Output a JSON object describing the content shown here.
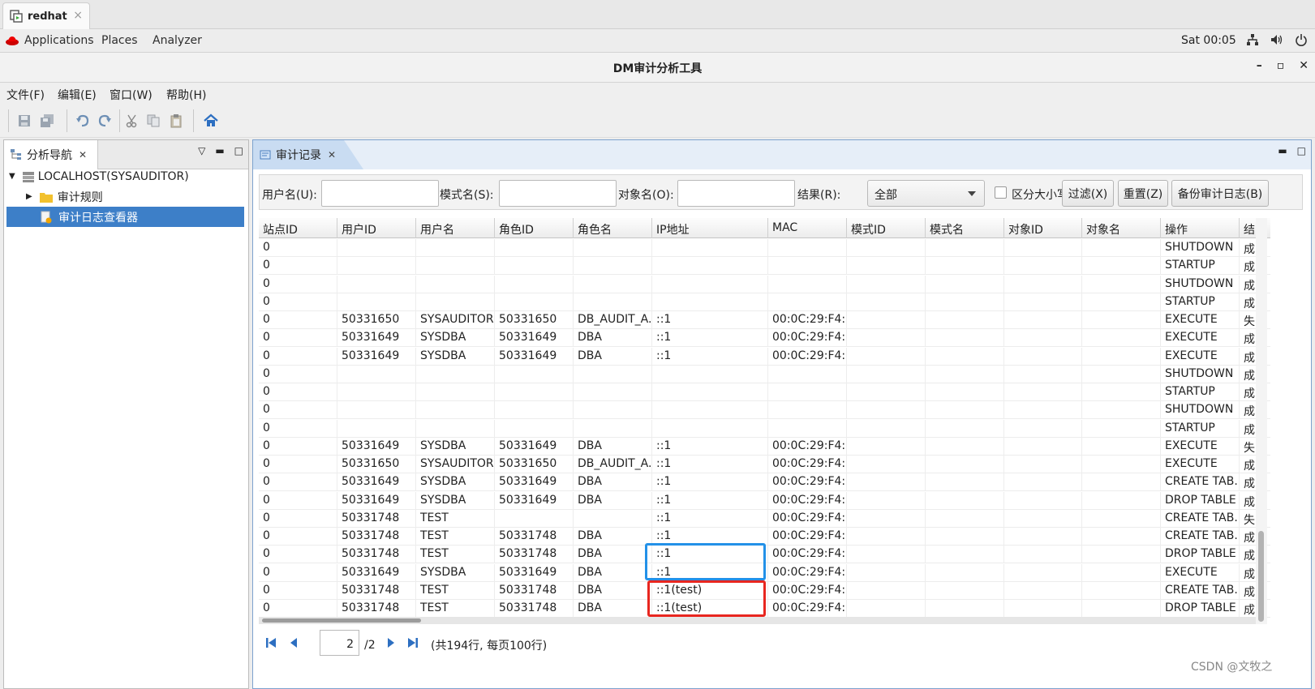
{
  "browser_tab": {
    "label": "redhat",
    "close": "×"
  },
  "topbar": {
    "applications": "Applications",
    "places": "Places",
    "analyzer": "Analyzer",
    "clock": "Sat 00:05"
  },
  "window": {
    "title": "DM审计分析工具",
    "minimize": "–",
    "maximize": "▫",
    "close": "✕"
  },
  "menu": {
    "file": "文件(F)",
    "edit": "编辑(E)",
    "window": "窗口(W)",
    "help": "帮助(H)"
  },
  "nav_panel": {
    "tab_label": "分析导航",
    "tree": {
      "root": "LOCALHOST(SYSAUDITOR)",
      "rules": "审计规则",
      "viewer": "审计日志查看器"
    }
  },
  "records_panel": {
    "tab_label": "审计记录"
  },
  "filter": {
    "username_label": "用户名(U):",
    "schema_label": "模式名(S):",
    "object_label": "对象名(O):",
    "result_label": "结果(R):",
    "result_value": "全部",
    "case_label": "区分大小写(C)",
    "filter_btn": "过滤(X)",
    "reset_btn": "重置(Z)",
    "backup_btn": "备份审计日志(B)"
  },
  "table": {
    "columns": [
      "站点ID",
      "用户ID",
      "用户名",
      "角色ID",
      "角色名",
      "IP地址",
      "MAC",
      "模式ID",
      "模式名",
      "对象ID",
      "对象名",
      "操作",
      "结"
    ],
    "rows": [
      [
        "0",
        "",
        "",
        "",
        "",
        "",
        "",
        "",
        "",
        "",
        "",
        "SHUTDOWN",
        "成"
      ],
      [
        "0",
        "",
        "",
        "",
        "",
        "",
        "",
        "",
        "",
        "",
        "",
        "STARTUP",
        "成"
      ],
      [
        "0",
        "",
        "",
        "",
        "",
        "",
        "",
        "",
        "",
        "",
        "",
        "SHUTDOWN",
        "成"
      ],
      [
        "0",
        "",
        "",
        "",
        "",
        "",
        "",
        "",
        "",
        "",
        "",
        "STARTUP",
        "成"
      ],
      [
        "0",
        "50331650",
        "SYSAUDITOR",
        "50331650",
        "DB_AUDIT_A...",
        "::1",
        "00:0C:29:F4:...",
        "",
        "",
        "",
        "",
        "EXECUTE",
        "失"
      ],
      [
        "0",
        "50331649",
        "SYSDBA",
        "50331649",
        "DBA",
        "::1",
        "00:0C:29:F4:...",
        "",
        "",
        "",
        "",
        "EXECUTE",
        "成"
      ],
      [
        "0",
        "50331649",
        "SYSDBA",
        "50331649",
        "DBA",
        "::1",
        "00:0C:29:F4:...",
        "",
        "",
        "",
        "",
        "EXECUTE",
        "成"
      ],
      [
        "0",
        "",
        "",
        "",
        "",
        "",
        "",
        "",
        "",
        "",
        "",
        "SHUTDOWN",
        "成"
      ],
      [
        "0",
        "",
        "",
        "",
        "",
        "",
        "",
        "",
        "",
        "",
        "",
        "STARTUP",
        "成"
      ],
      [
        "0",
        "",
        "",
        "",
        "",
        "",
        "",
        "",
        "",
        "",
        "",
        "SHUTDOWN",
        "成"
      ],
      [
        "0",
        "",
        "",
        "",
        "",
        "",
        "",
        "",
        "",
        "",
        "",
        "STARTUP",
        "成"
      ],
      [
        "0",
        "50331649",
        "SYSDBA",
        "50331649",
        "DBA",
        "::1",
        "00:0C:29:F4:...",
        "",
        "",
        "",
        "",
        "EXECUTE",
        "失"
      ],
      [
        "0",
        "50331650",
        "SYSAUDITOR",
        "50331650",
        "DB_AUDIT_A...",
        "::1",
        "00:0C:29:F4:...",
        "",
        "",
        "",
        "",
        "EXECUTE",
        "成"
      ],
      [
        "0",
        "50331649",
        "SYSDBA",
        "50331649",
        "DBA",
        "::1",
        "00:0C:29:F4:...",
        "",
        "",
        "",
        "",
        "CREATE TAB...",
        "成"
      ],
      [
        "0",
        "50331649",
        "SYSDBA",
        "50331649",
        "DBA",
        "::1",
        "00:0C:29:F4:...",
        "",
        "",
        "",
        "",
        "DROP TABLE",
        "成"
      ],
      [
        "0",
        "50331748",
        "TEST",
        "",
        "",
        "::1",
        "00:0C:29:F4:...",
        "",
        "",
        "",
        "",
        "CREATE TAB...",
        "失"
      ],
      [
        "0",
        "50331748",
        "TEST",
        "50331748",
        "DBA",
        "::1",
        "00:0C:29:F4:...",
        "",
        "",
        "",
        "",
        "CREATE TAB...",
        "成"
      ],
      [
        "0",
        "50331748",
        "TEST",
        "50331748",
        "DBA",
        "::1",
        "00:0C:29:F4:...",
        "",
        "",
        "",
        "",
        "DROP TABLE",
        "成"
      ],
      [
        "0",
        "50331649",
        "SYSDBA",
        "50331649",
        "DBA",
        "::1",
        "00:0C:29:F4:...",
        "",
        "",
        "",
        "",
        "EXECUTE",
        "成"
      ],
      [
        "0",
        "50331748",
        "TEST",
        "50331748",
        "DBA",
        "::1(test)",
        "00:0C:29:F4:...",
        "",
        "",
        "",
        "",
        "CREATE TAB...",
        "成"
      ],
      [
        "0",
        "50331748",
        "TEST",
        "50331748",
        "DBA",
        "::1(test)",
        "00:0C:29:F4:...",
        "",
        "",
        "",
        "",
        "DROP TABLE",
        "成"
      ]
    ]
  },
  "pager": {
    "page": "2",
    "total_pages": "/2",
    "summary": "(共194行, 每页100行)"
  },
  "watermark": "CSDN @文牧之",
  "colors": {
    "accent": "#3d7fc8",
    "highlight_blue": "#2391e8",
    "highlight_red": "#e8261f"
  }
}
